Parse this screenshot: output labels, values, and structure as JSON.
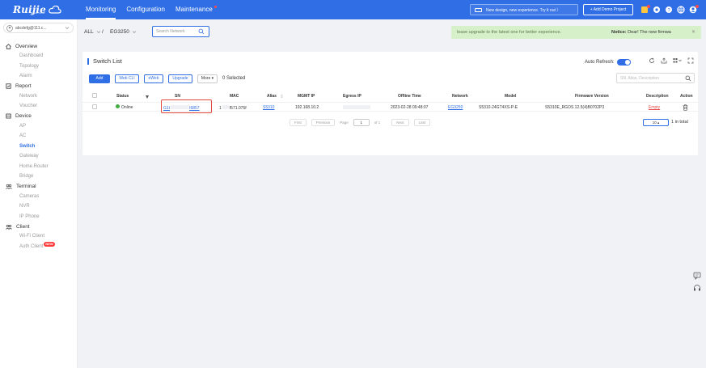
{
  "brand": {
    "name": "Ruijie",
    "tagline": "Reyee Cloud"
  },
  "top_nav": {
    "items": [
      {
        "label": "Monitoring",
        "active": true
      },
      {
        "label": "Configuration",
        "active": false
      },
      {
        "label": "Maintenance",
        "active": false
      }
    ],
    "new_design_label": "New design, new experience. Try it out  〉",
    "add_demo_label": "+ Add Demo Project",
    "accent": "#2f6ee5"
  },
  "sidebar": {
    "account": "abcdefg@111.c...",
    "groups": [
      {
        "label": "Overview",
        "icon": "home-icon",
        "items": [
          "Dashboard",
          "Topology",
          "Alarm"
        ]
      },
      {
        "label": "Report",
        "icon": "report-icon",
        "items": [
          "Network",
          "Voucher"
        ]
      },
      {
        "label": "Device",
        "icon": "device-icon",
        "items": [
          "AP",
          "AC",
          "Switch",
          "Gateway",
          "Home Router",
          "Bridge"
        ]
      },
      {
        "label": "Terminal",
        "icon": "terminal-icon",
        "items": [
          "Cameras",
          "NVR",
          "IP Phone"
        ]
      },
      {
        "label": "Client",
        "icon": "client-icon",
        "items": [
          "Wi-Fi Client",
          "Auth Client"
        ]
      }
    ],
    "active_item": "Switch",
    "new_badge": "NEW"
  },
  "breadcrumb": {
    "scope": "ALL",
    "separator": "/",
    "network": "EG3250"
  },
  "search_network": {
    "placeholder": "Search Network"
  },
  "notice": {
    "text": "lease upgrade to the latest one for better experience.",
    "label": "Notice:",
    "text_right": "Dear! The new firmwa"
  },
  "panel": {
    "title": "Switch List",
    "auto_refresh_label": "Auto Refresh:",
    "buttons": {
      "add": "Add",
      "web_cli": "Web CLI",
      "eweb": "eWeb",
      "upgrade": "Upgrade",
      "more": "More ▾"
    },
    "selected_text": "0 Selected",
    "search_placeholder": "SN, Alias, Description"
  },
  "table": {
    "columns": [
      "Status",
      "SN",
      "MAC",
      "Alias",
      "MGMT IP",
      "Egress IP",
      "Offline Time",
      "Network",
      "Model",
      "Firmware Version",
      "Description",
      "Action"
    ],
    "rows": [
      {
        "status": "Online",
        "sn_prefix": "G1I",
        "sn_suffix": "I6857",
        "mac_prefix": "1",
        "mac_suffix": "f571.075f",
        "alias": "S5310",
        "mgmt_ip": "192.168.10.2",
        "egress_ip": "",
        "offline_time": "2023-02-28 09:48:07",
        "network": "EG3250",
        "model": "S5310-24GT4XS-P-E",
        "firmware": "S5310E_RGOS 12.5(4)B0702P3",
        "description": "Empty",
        "action_icon": "delete-icon"
      }
    ]
  },
  "pagination": {
    "first": "First",
    "previous": "Previous",
    "page_label": "Page",
    "page": "1",
    "of": "of 1",
    "next": "Next",
    "last": "Last",
    "per_page": "10 ▴",
    "total": "1 in total"
  },
  "colors": {
    "online": "#3fae3f",
    "highlight_box": "#e2463b",
    "empty_link": "#e84a4a"
  }
}
